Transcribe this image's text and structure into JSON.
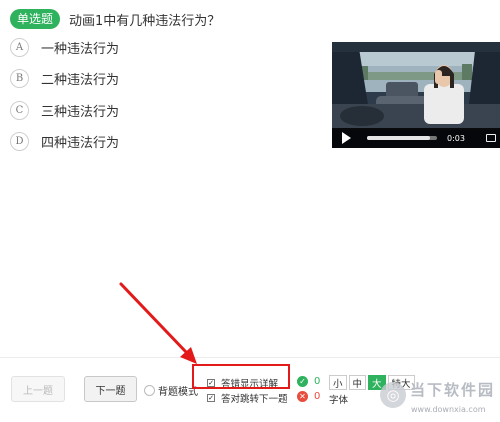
{
  "question": {
    "type_badge": "单选题",
    "text": "动画1中有几种违法行为？",
    "options": [
      {
        "key": "A",
        "label": "一种违法行为"
      },
      {
        "key": "B",
        "label": "二种违法行为"
      },
      {
        "key": "C",
        "label": "三种违法行为"
      },
      {
        "key": "D",
        "label": "四种违法行为"
      }
    ]
  },
  "video": {
    "time": "0:03",
    "progress_fraction": 0.9
  },
  "footer": {
    "prev_label": "上一题",
    "next_label": "下一题",
    "recite_mode_label": "背题模式",
    "show_detail_label": "答错显示详解",
    "auto_next_label": "答对跳转下一题",
    "correct_count": "0",
    "wrong_count": "0",
    "font_sizes": [
      "小",
      "中",
      "大",
      "特大"
    ],
    "font_active": "大",
    "font_label": "字体"
  },
  "watermark": {
    "name": "当下软件园",
    "url": "www.downxia.com"
  },
  "colors": {
    "accent": "#2fb25e",
    "error": "#e74c3c",
    "annotation": "#e21a1a"
  }
}
